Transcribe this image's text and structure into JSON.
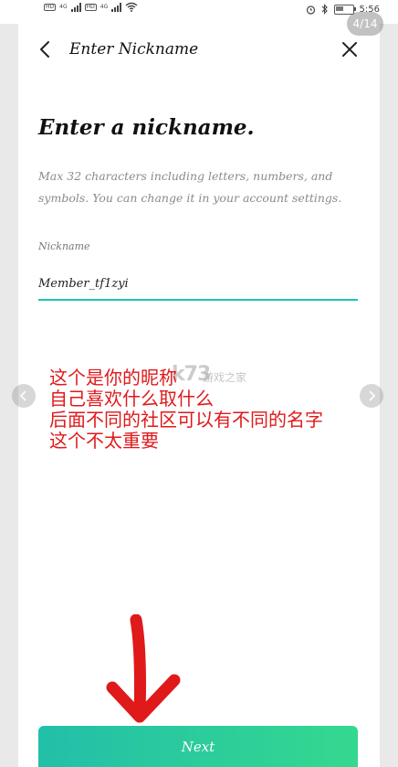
{
  "status_bar": {
    "network_badge_1": "HD",
    "network_label_1": "4G",
    "network_badge_2": "HD",
    "network_label_2": "4G",
    "time": "5:56"
  },
  "viewer": {
    "page_counter": "4/14"
  },
  "header": {
    "title": "Enter Nickname",
    "back_icon": "back-arrow-icon",
    "close_icon": "close-icon"
  },
  "main": {
    "heading": "Enter a nickname.",
    "description": "Max 32 characters including letters, numbers, and symbols. You can change it in your account settings.",
    "field_label": "Nickname",
    "field_value": "Member_tf1zyi",
    "accent_color": "#20c4b7"
  },
  "annotation": {
    "lines": [
      "这个是你的昵称",
      "自己喜欢什么取什么",
      "后面不同的社区可以有不同的名字",
      "这个不太重要"
    ],
    "color": "#e0191b"
  },
  "watermark": {
    "text": "k73",
    "sub": "游戏之家"
  },
  "footer": {
    "next_label": "Next"
  }
}
